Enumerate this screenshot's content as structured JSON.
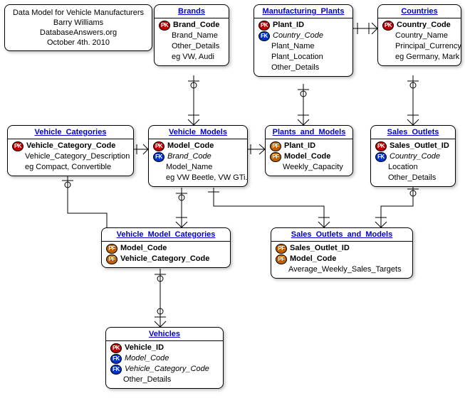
{
  "note": {
    "line1": "Data Model for Vehicle Manufacturers",
    "line2": "Barry Williams",
    "line3": "DatabaseAnswers.org",
    "line4": "October 4th. 2010"
  },
  "entities": {
    "brands": {
      "title": "Brands",
      "rows": [
        {
          "key": "PK",
          "name": "Brand_Code",
          "bold": true
        },
        {
          "name": "Brand_Name"
        },
        {
          "name": "Other_Details"
        },
        {
          "name": "eg VW, Audi"
        }
      ]
    },
    "manufacturing_plants": {
      "title": "Manufacturing_Plants",
      "rows": [
        {
          "key": "PK",
          "name": "Plant_ID",
          "bold": true
        },
        {
          "key": "FK",
          "name": "Country_Code",
          "italic": true
        },
        {
          "name": "Plant_Name"
        },
        {
          "name": "Plant_Location"
        },
        {
          "name": "Other_Details"
        }
      ]
    },
    "countries": {
      "title": "Countries",
      "rows": [
        {
          "key": "PK",
          "name": "Country_Code",
          "bold": true
        },
        {
          "name": "Country_Name"
        },
        {
          "name": "Principal_Currency"
        },
        {
          "name": "eg Germany, Mark"
        }
      ]
    },
    "vehicle_categories": {
      "title": "Vehicle_Categories",
      "rows": [
        {
          "key": "PK",
          "name": "Vehicle_Category_Code",
          "bold": true
        },
        {
          "name": "Vehicle_Category_Description"
        },
        {
          "name": "eg Compact, Convertible"
        }
      ]
    },
    "vehicle_models": {
      "title": "Vehicle_Models",
      "rows": [
        {
          "key": "PK",
          "name": "Model_Code",
          "bold": true
        },
        {
          "key": "FK",
          "name": "Brand_Code",
          "italic": true
        },
        {
          "name": "Model_Name"
        },
        {
          "name": "eg VW Beetle, VW GTi."
        }
      ]
    },
    "plants_and_models": {
      "title": "Plants_and_Models",
      "rows": [
        {
          "key": "PF",
          "name": "Plant_ID",
          "bold": true
        },
        {
          "key": "PF",
          "name": "Model_Code",
          "bold": true
        },
        {
          "name": "Weekly_Capacity"
        }
      ]
    },
    "sales_outlets": {
      "title": "Sales_Outlets",
      "rows": [
        {
          "key": "PK",
          "name": "Sales_Outlet_ID",
          "bold": true
        },
        {
          "key": "FK",
          "name": "Country_Code",
          "italic": true
        },
        {
          "name": "Location"
        },
        {
          "name": "Other_Details"
        }
      ]
    },
    "vehicle_model_categories": {
      "title": "Vehicle_Model_Categories",
      "rows": [
        {
          "key": "PF",
          "name": "Model_Code",
          "bold": true
        },
        {
          "key": "PF",
          "name": "Vehicle_Category_Code",
          "bold": true
        }
      ]
    },
    "sales_outlets_and_models": {
      "title": "Sales_Outlets_and_Models",
      "rows": [
        {
          "key": "PF",
          "name": "Sales_Outlet_ID",
          "bold": true
        },
        {
          "key": "PF",
          "name": "Model_Code",
          "bold": true
        },
        {
          "name": "Average_Weekly_Sales_Targets"
        }
      ]
    },
    "vehicles": {
      "title": "Vehicles",
      "rows": [
        {
          "key": "PK",
          "name": "Vehicle_ID",
          "bold": true
        },
        {
          "key": "FK",
          "name": "Model_Code",
          "italic": true
        },
        {
          "key": "FK",
          "name": "Vehicle_Category_Code",
          "italic": true
        },
        {
          "name": "Other_Details"
        }
      ]
    }
  },
  "keyLabels": {
    "PK": "PK",
    "FK": "FK",
    "PF": "PF"
  }
}
